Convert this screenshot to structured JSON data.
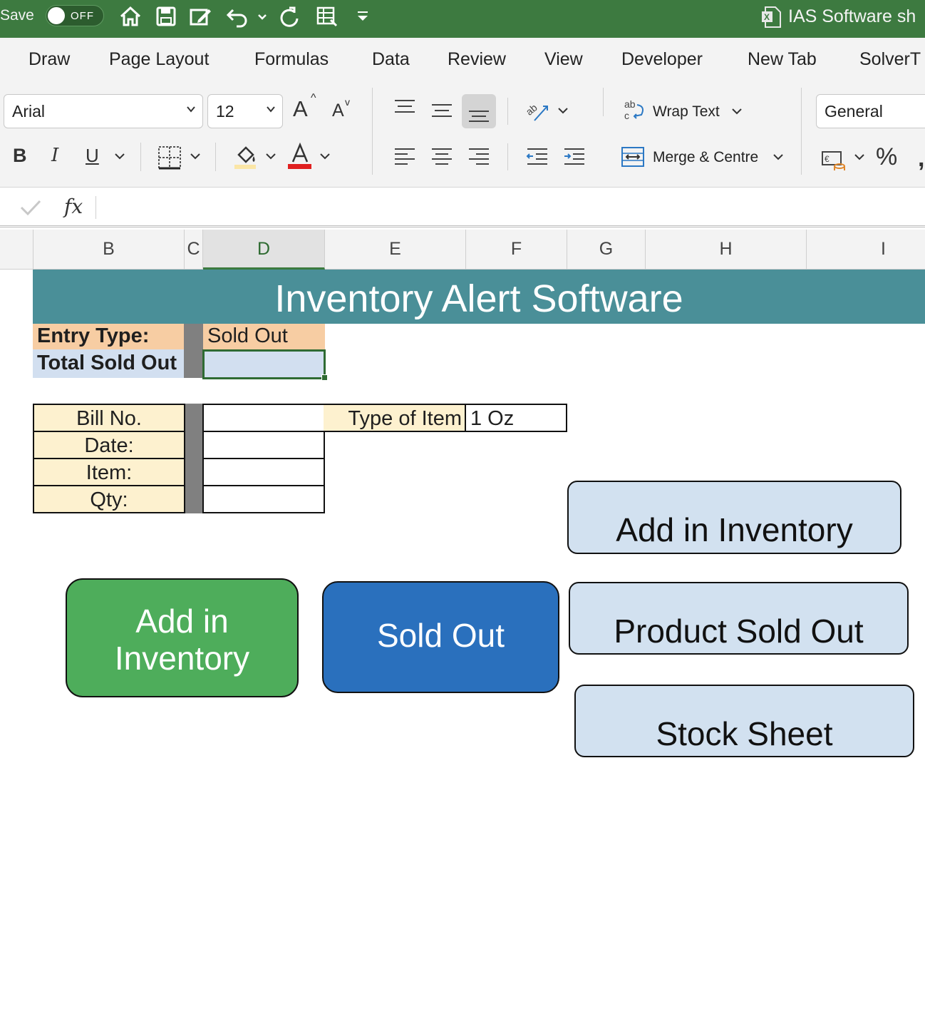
{
  "titlebar": {
    "autosave_label": "Save",
    "toggle_state": "OFF",
    "icons": [
      "home-icon",
      "save-icon",
      "edit-document-icon",
      "undo-icon",
      "redo-icon",
      "form-icon",
      "customize-toolbar-icon"
    ],
    "document_title": "IAS Software sh",
    "background_color": "#3d7a40"
  },
  "ribbon_tabs": [
    "Draw",
    "Page Layout",
    "Formulas",
    "Data",
    "Review",
    "View",
    "Developer",
    "New Tab",
    "SolverT"
  ],
  "ribbon": {
    "font_name": "Arial",
    "font_size": "12",
    "increase_font_glyph": "A",
    "decrease_font_glyph": "A",
    "bold": "B",
    "italic": "I",
    "underline": "U",
    "wrap_text": "Wrap Text",
    "merge_centre": "Merge & Centre",
    "number_format": "General",
    "percent": "%"
  },
  "formula_bar": {
    "fx": "fx",
    "content": ""
  },
  "columns": [
    {
      "label": "",
      "active": false
    },
    {
      "label": "B",
      "active": false
    },
    {
      "label": "C",
      "active": false
    },
    {
      "label": "D",
      "active": true
    },
    {
      "label": "E",
      "active": false
    },
    {
      "label": "F",
      "active": false
    },
    {
      "label": "G",
      "active": false
    },
    {
      "label": "H",
      "active": false
    },
    {
      "label": "I",
      "active": false
    }
  ],
  "sheet": {
    "banner_title": "Inventory Alert Software",
    "entry_type_label": "Entry Type:",
    "entry_type_value": "Sold Out",
    "total_sold_out_label": "Total Sold Out",
    "total_sold_out_value": "",
    "form_labels": [
      "Bill No.",
      "Date:",
      "Item:",
      "Qty:"
    ],
    "type_of_item_label": "Type of Item",
    "type_of_item_value": "1 Oz",
    "banner_color": "#4a8f98"
  },
  "buttons": {
    "add_in_inventory_green": "Add in Inventory",
    "sold_out_blue": "Sold Out",
    "add_in_inventory_light": "Add in Inventory",
    "product_sold_out": "Product Sold Out",
    "stock_sheet": "Stock Sheet",
    "green_color": "#4ead5b",
    "blue_color": "#2a70bd",
    "light_color": "#d2e1f0"
  }
}
